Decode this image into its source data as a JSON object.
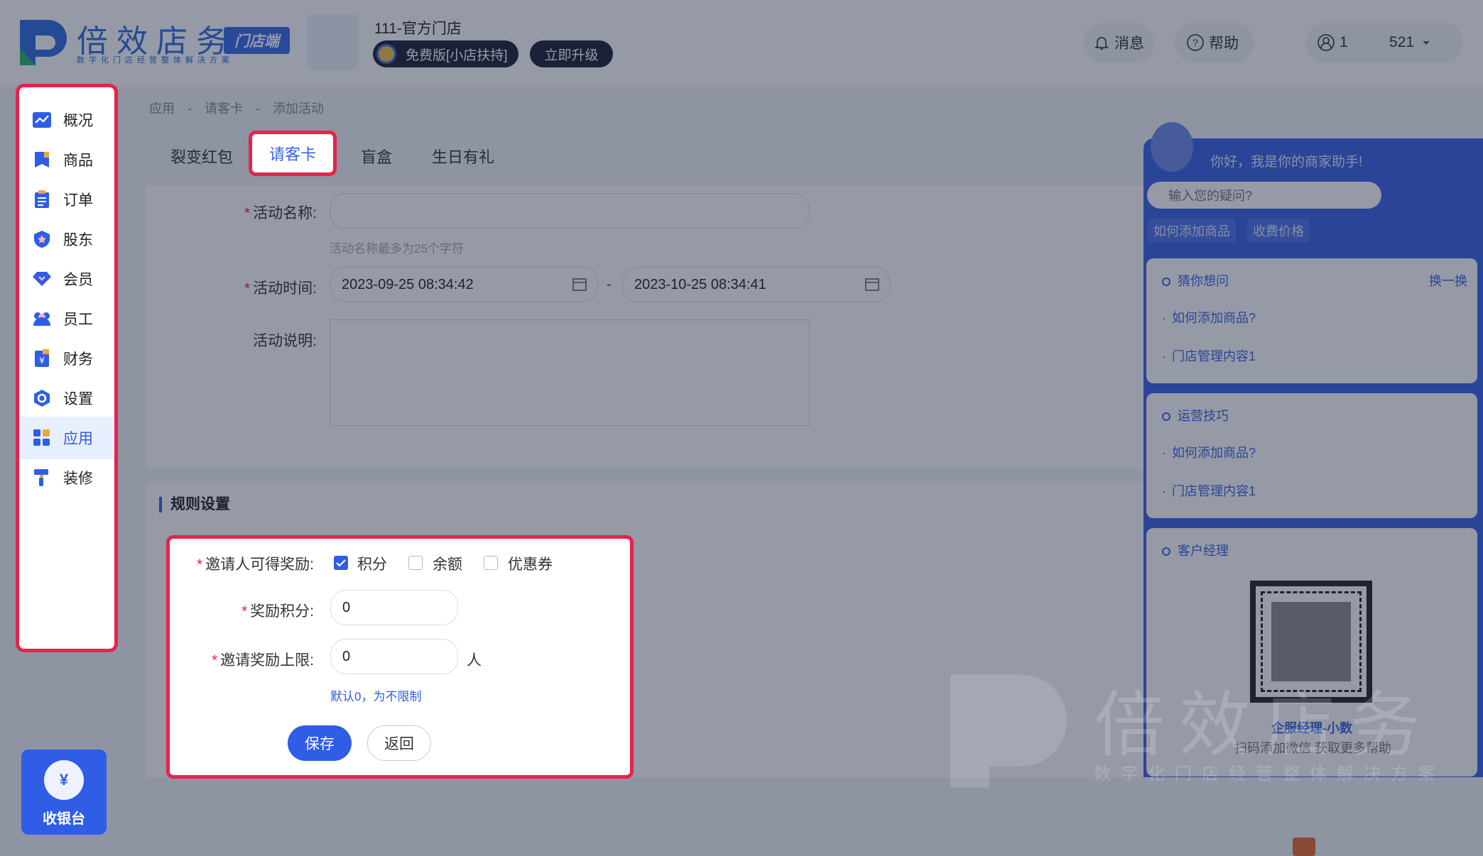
{
  "header": {
    "logo_text": "倍效店务",
    "logo_sub": "数字化门店经营整体解决方案",
    "store_tag": "门店端",
    "store_name": "111-官方门店",
    "edition": "免费版[小店扶持]",
    "upgrade": "立即升级",
    "messages": "消息",
    "help": "帮助",
    "user": "1          521"
  },
  "sidebar": {
    "items": [
      {
        "label": "概况",
        "icon": "chart-icon"
      },
      {
        "label": "商品",
        "icon": "goods-icon"
      },
      {
        "label": "订单",
        "icon": "order-icon"
      },
      {
        "label": "股东",
        "icon": "shareholder-icon"
      },
      {
        "label": "会员",
        "icon": "member-icon"
      },
      {
        "label": "员工",
        "icon": "staff-icon"
      },
      {
        "label": "财务",
        "icon": "finance-icon"
      },
      {
        "label": "设置",
        "icon": "settings-icon"
      },
      {
        "label": "应用",
        "icon": "apps-icon",
        "active": true
      },
      {
        "label": "装修",
        "icon": "decorate-icon"
      }
    ],
    "cashier": "收银台"
  },
  "breadcrumb": [
    "应用",
    "-",
    "请客卡",
    "-",
    "添加活动"
  ],
  "tabs": [
    "裂变红包",
    "请客卡",
    "盲盒",
    "生日有礼"
  ],
  "form": {
    "name_label": "活动名称:",
    "name_value": "",
    "name_hint": "活动名称最多为25个字符",
    "time_label": "活动时间:",
    "start_time": "2023-09-25 08:34:42",
    "end_time": "2023-10-25 08:34:41",
    "range_sep": "-",
    "desc_label": "活动说明:"
  },
  "rules": {
    "title": "规则设置",
    "reward_label": "邀请人可得奖励:",
    "options": [
      {
        "label": "积分",
        "checked": true
      },
      {
        "label": "余额",
        "checked": false
      },
      {
        "label": "优惠券",
        "checked": false
      }
    ],
    "points_label": "奖励积分:",
    "points_value": "0",
    "limit_label": "邀请奖励上限:",
    "limit_value": "0",
    "limit_unit": "人",
    "limit_hint": "默认0，为不限制",
    "save": "保存",
    "back": "返回"
  },
  "assistant": {
    "greeting": "你好，我是你的商家助手!",
    "input_placeholder": "输入您的疑问?",
    "quick_tags": [
      "如何添加商品",
      "收费价格"
    ],
    "guess_title": "猜你想问",
    "swap": "换一换",
    "guess_links": [
      "如何添加商品?",
      "门店管理内容1"
    ],
    "tips_title": "运营技巧",
    "tips_links": [
      "如何添加商品?",
      "门店管理内容1"
    ],
    "manager_title": "客户经理",
    "manager_name": "企服经理-小数",
    "manager_sub": "扫码添加微信 获取更多帮助"
  },
  "watermark": {
    "text": "倍效店务",
    "sub": "数字化门店经营整体解决方案"
  },
  "colors": {
    "primary": "#2f5de6",
    "highlight": "#e5234d",
    "required": "#e5234d"
  }
}
